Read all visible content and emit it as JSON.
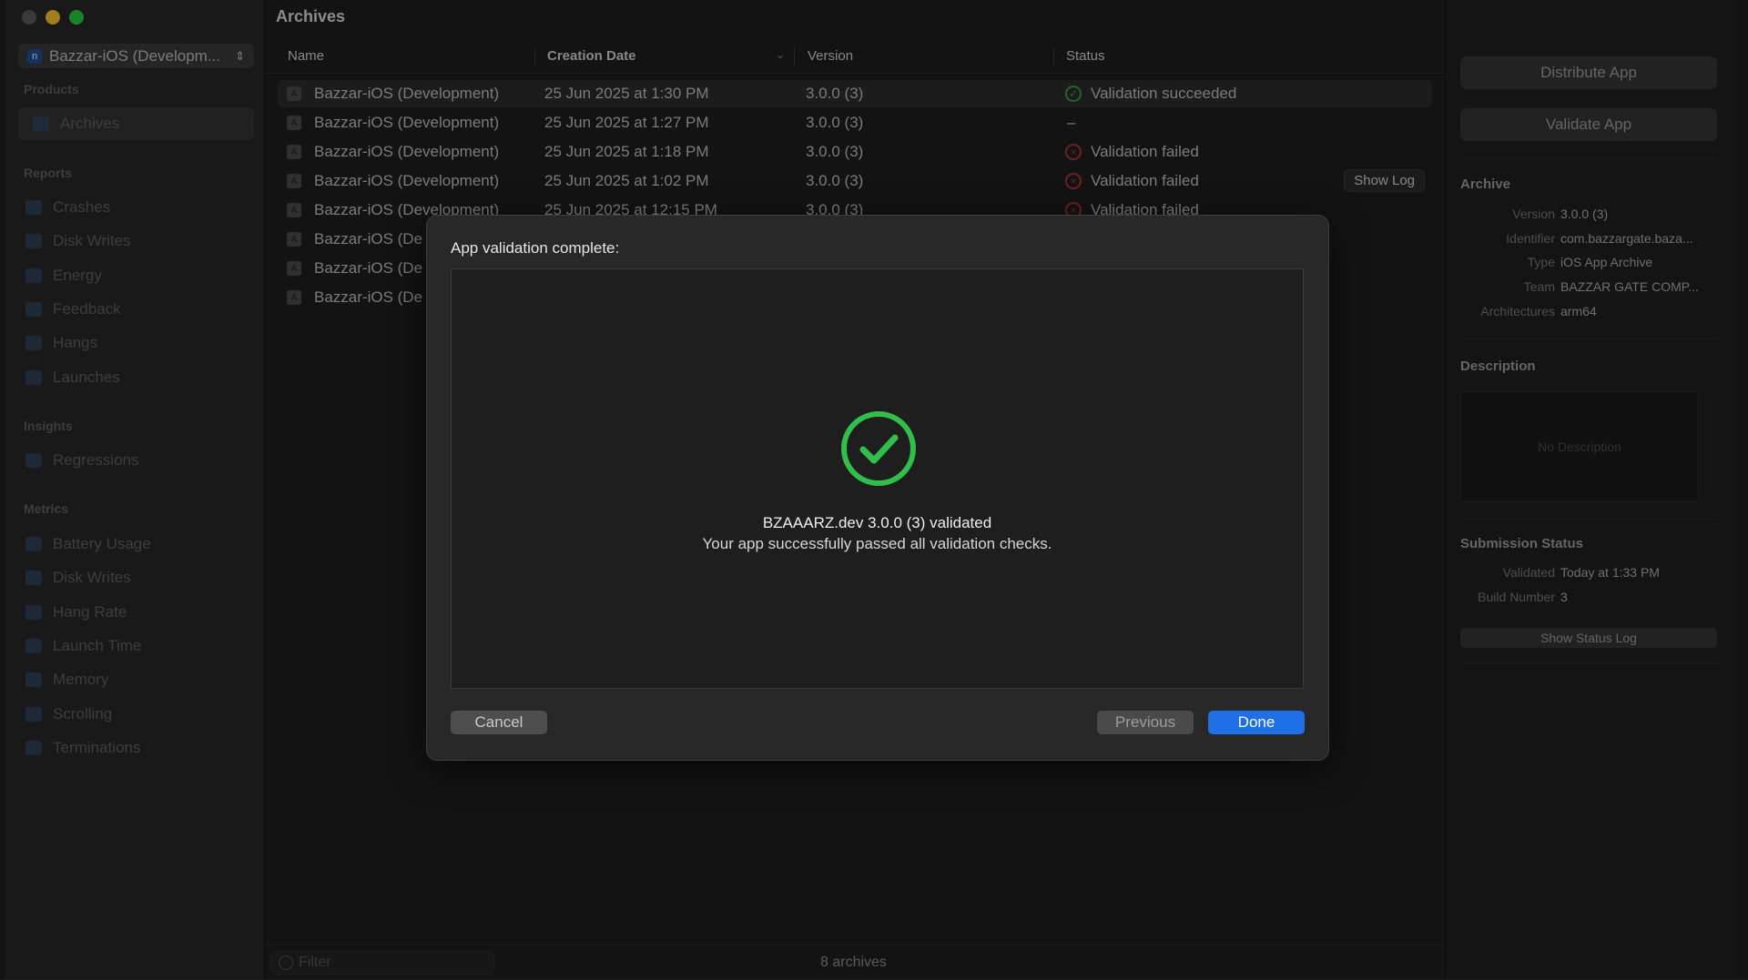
{
  "window": {
    "scheme_label": "Bazzar-iOS (Developm...",
    "scheme_icon": "n"
  },
  "sidebar": {
    "sections": [
      {
        "title": "Products",
        "items": [
          "Archives"
        ]
      },
      {
        "title": "Reports",
        "items": [
          "Crashes",
          "Disk Writes",
          "Energy",
          "Feedback",
          "Hangs",
          "Launches"
        ]
      },
      {
        "title": "Insights",
        "items": [
          "Regressions"
        ]
      },
      {
        "title": "Metrics",
        "items": [
          "Battery Usage",
          "Disk Writes",
          "Hang Rate",
          "Launch Time",
          "Memory",
          "Scrolling",
          "Terminations"
        ]
      }
    ],
    "products_title": "Products",
    "reports_title": "Reports",
    "insights_title": "Insights",
    "metrics_title": "Metrics",
    "archives": "Archives",
    "crashes": "Crashes",
    "disk_writes": "Disk Writes",
    "energy": "Energy",
    "feedback": "Feedback",
    "hangs": "Hangs",
    "launches": "Launches",
    "regressions": "Regressions",
    "battery_usage": "Battery Usage",
    "disk_writes_metric": "Disk Writes",
    "hang_rate": "Hang Rate",
    "launch_time": "Launch Time",
    "memory": "Memory",
    "scrolling": "Scrolling",
    "terminations": "Terminations"
  },
  "main": {
    "title": "Archives",
    "columns": {
      "name": "Name",
      "date": "Creation Date",
      "version": "Version",
      "status": "Status"
    },
    "rows": [
      {
        "name": "Bazzar-iOS (Development)",
        "date": "25 Jun 2025 at 1:30 PM",
        "version": "3.0.0 (3)",
        "status": "Validation succeeded"
      },
      {
        "name": "Bazzar-iOS (Development)",
        "date": "25 Jun 2025 at 1:27 PM",
        "version": "3.0.0 (3)",
        "status": "–"
      },
      {
        "name": "Bazzar-iOS (Development)",
        "date": "25 Jun 2025 at 1:18 PM",
        "version": "3.0.0 (3)",
        "status": "Validation failed"
      },
      {
        "name": "Bazzar-iOS (Development)",
        "date": "25 Jun 2025 at 1:02 PM",
        "version": "3.0.0 (3)",
        "status": "Validation failed"
      },
      {
        "name": "Bazzar-iOS (Development)",
        "date": "25 Jun 2025 at 12:15 PM",
        "version": "3.0.0 (3)",
        "status": "Validation failed"
      },
      {
        "name": "Bazzar-iOS (De",
        "date": "",
        "version": "",
        "status": ""
      },
      {
        "name": "Bazzar-iOS (De",
        "date": "",
        "version": "",
        "status": ""
      },
      {
        "name": "Bazzar-iOS (De",
        "date": "",
        "version": "",
        "status": ""
      }
    ],
    "show_log": "Show Log",
    "filter_placeholder": "Filter",
    "count": "8 archives"
  },
  "inspector": {
    "distribute": "Distribute App",
    "validate": "Validate App",
    "archive_title": "Archive",
    "version_k": "Version",
    "version_v": "3.0.0 (3)",
    "identifier_k": "Identifier",
    "identifier_v": "com.bazzargate.baza...",
    "type_k": "Type",
    "type_v": "iOS App Archive",
    "team_k": "Team",
    "team_v": "BAZZAR GATE COMP...",
    "arch_k": "Architectures",
    "arch_v": "arm64",
    "description_title": "Description",
    "no_description": "No Description",
    "submission_title": "Submission Status",
    "validated_k": "Validated",
    "validated_v": "Today at 1:33 PM",
    "build_k": "Build Number",
    "build_v": "3",
    "show_status_log": "Show Status Log"
  },
  "modal": {
    "title": "App validation complete:",
    "headline": "BZAAARZ.dev 3.0.0 (3) validated",
    "message": "Your app successfully passed all validation checks.",
    "cancel": "Cancel",
    "previous": "Previous",
    "done": "Done"
  },
  "colors": {
    "accent": "#1f6fe6",
    "success": "#2fbf4a",
    "error": "#a63232"
  }
}
